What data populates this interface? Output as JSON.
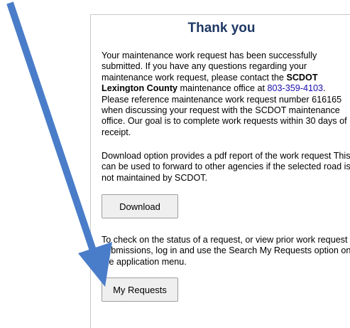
{
  "heading": "Thank you",
  "message": {
    "part1": "Your maintenance work request has been successfully submitted. If you have any questions regarding your maintenance work request, please contact the ",
    "office_name": "SCDOT Lexington County",
    "part2": " maintenance office at ",
    "phone": "803-359-4103",
    "part3": ". Please reference maintenance work request number 616165 when discussing your request with the SCDOT maintenance office. Our goal is to complete work requests within 30 days of receipt."
  },
  "download_info": "Download option provides a pdf report of the work request This can be used to forward to other agencies if the selected road is not maintained by SCDOT.",
  "download_button": "Download",
  "status_info": "To check on the status of a request, or view prior work request submissions, log in and use the Search My Requests option on the application menu.",
  "my_requests_button": "My Requests",
  "arrow_color": "#4a7dc9"
}
